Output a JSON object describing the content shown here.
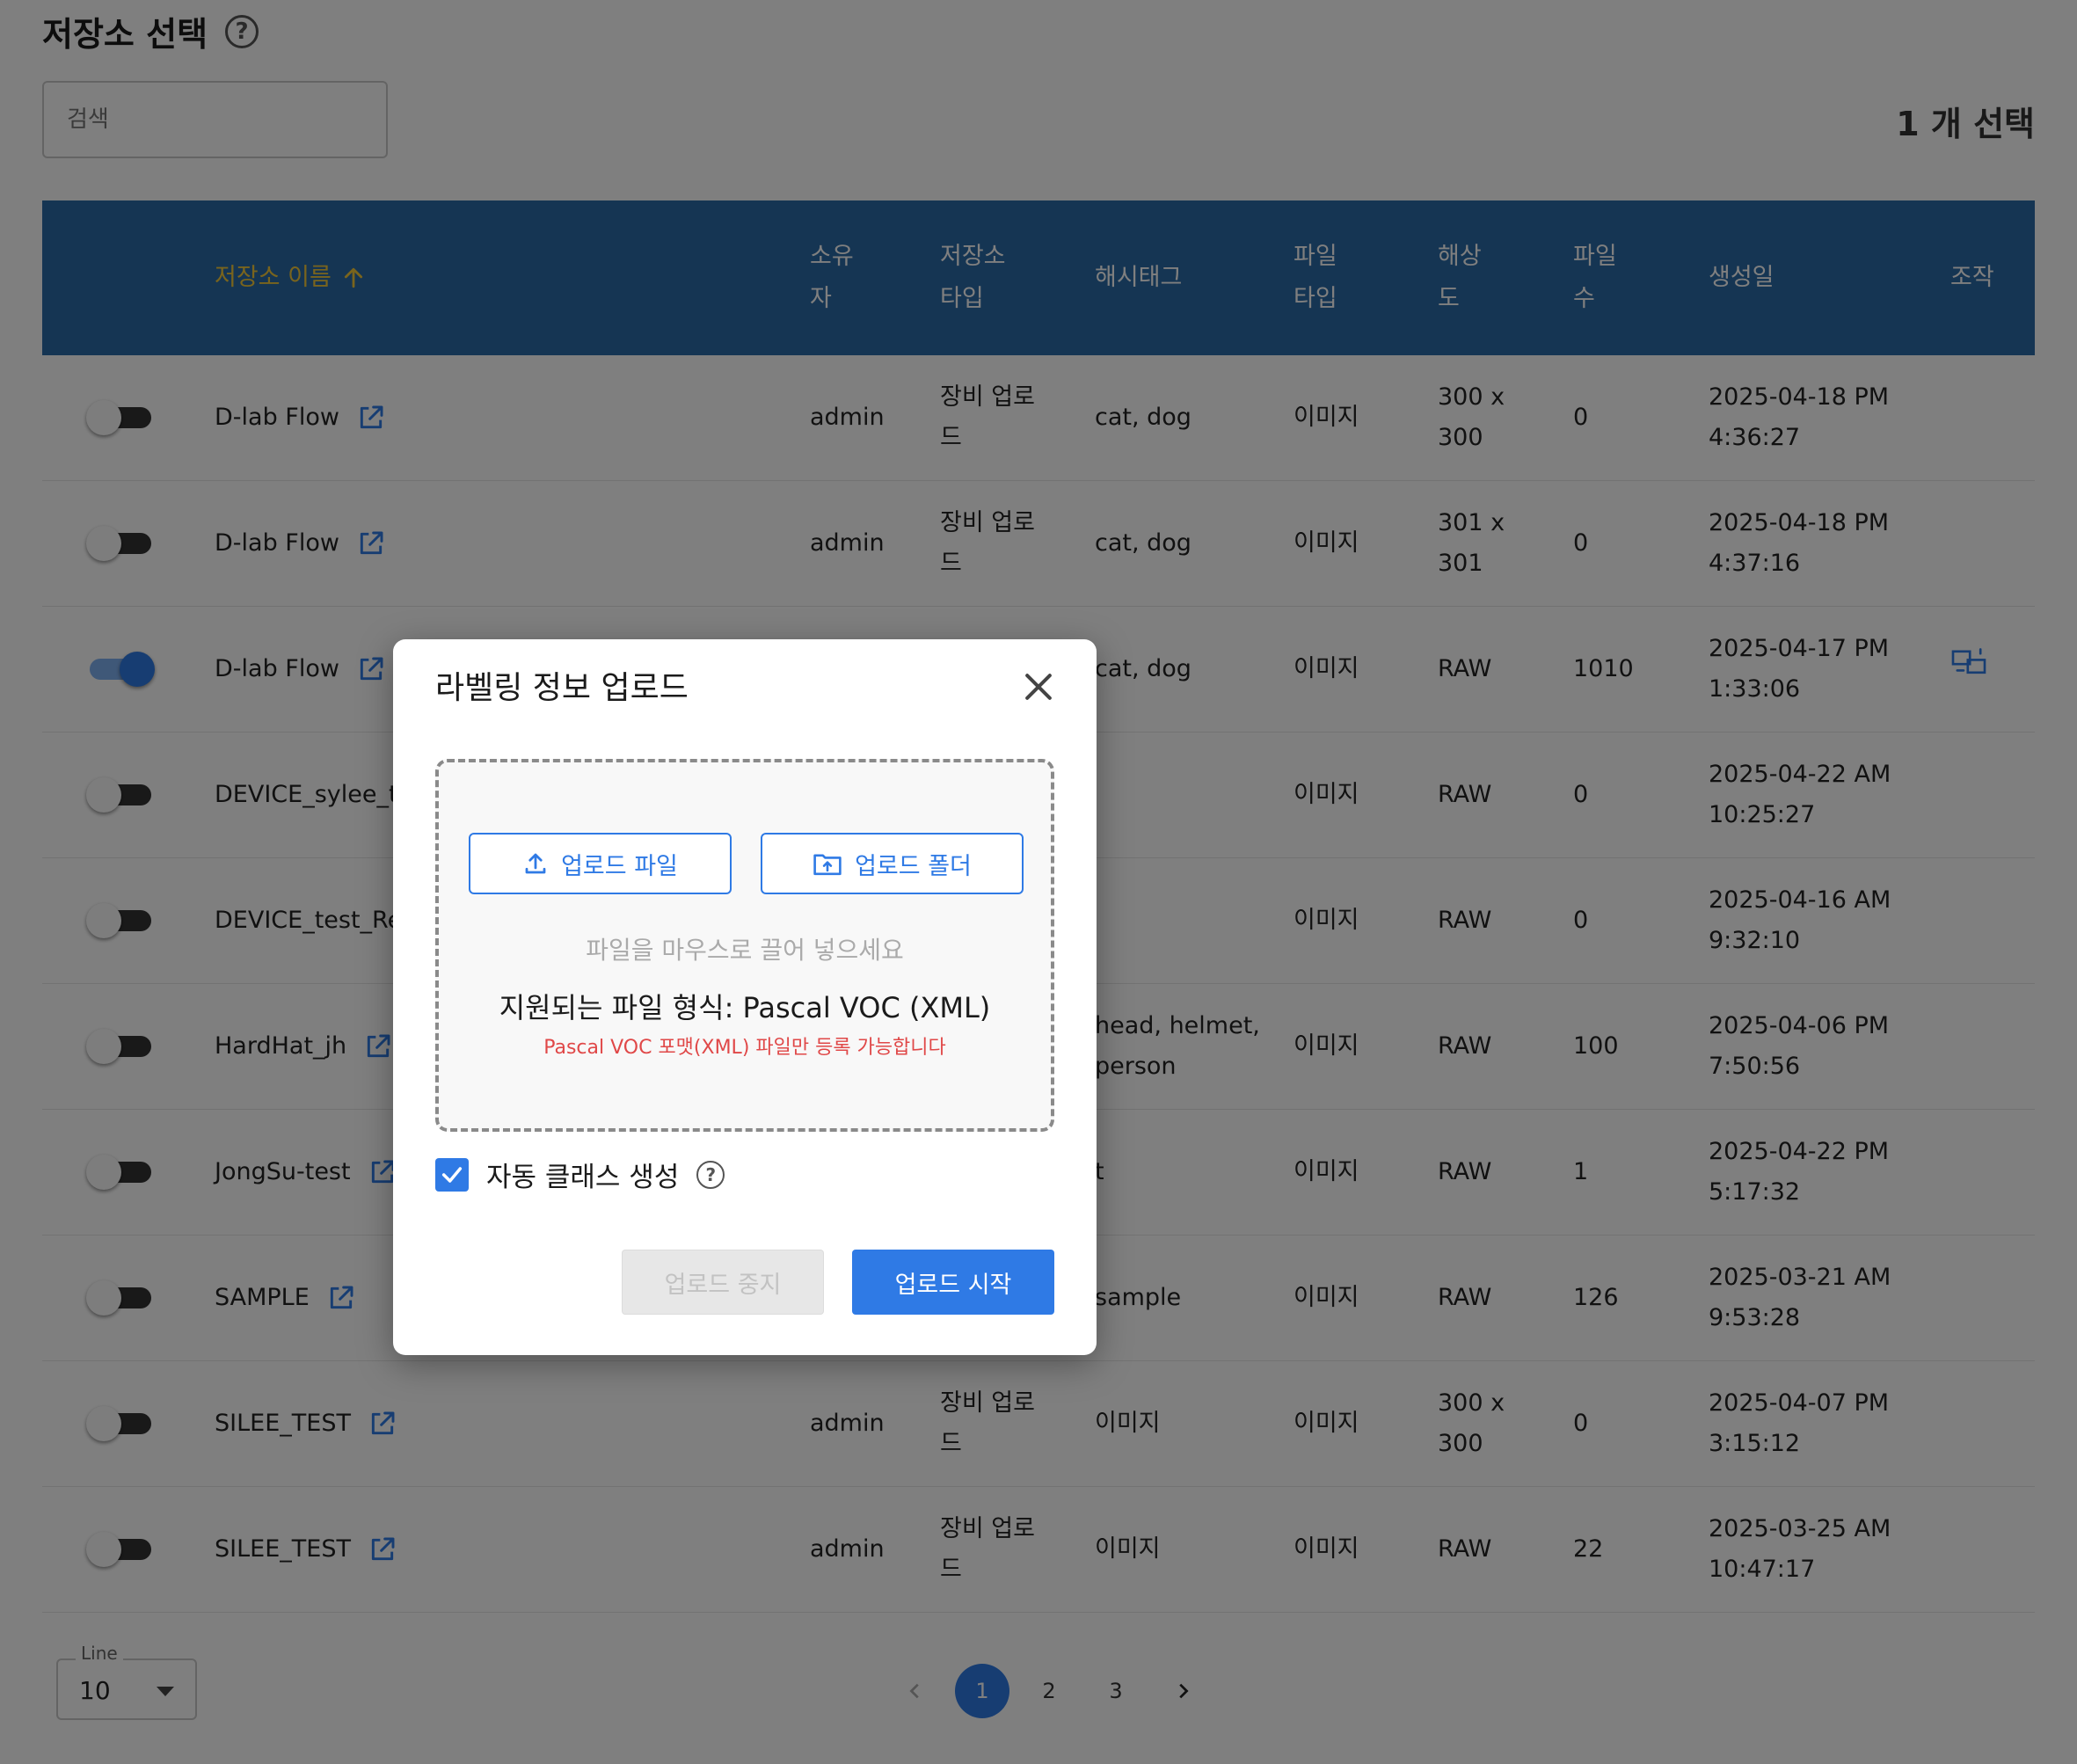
{
  "header": {
    "title": "저장소 선택",
    "help_icon": "help-circle-icon"
  },
  "search": {
    "placeholder": "검색"
  },
  "selection": {
    "count_label": "1 개 선택"
  },
  "table": {
    "columns": {
      "name": "저장소 이름",
      "owner": "소유\n자",
      "repo_type": "저장소\n타입",
      "hashtags": "해시태그",
      "file_type": "파일\n타입",
      "resolution": "해상\n도",
      "file_count": "파일\n수",
      "created": "생성일",
      "actions": "조작"
    },
    "sort": {
      "column": "name",
      "direction": "asc",
      "icon": "arrow-up-icon"
    },
    "rows": [
      {
        "enabled": false,
        "name": "D-lab Flow",
        "owner": "admin",
        "repo_type": "장비 업로\n드",
        "hashtags": "cat, dog",
        "file_type": "이미지",
        "resolution": "300 x\n300",
        "file_count": "0",
        "created": "2025-04-18 PM\n4:36:27"
      },
      {
        "enabled": false,
        "name": "D-lab Flow",
        "owner": "admin",
        "repo_type": "장비 업로\n드",
        "hashtags": "cat, dog",
        "file_type": "이미지",
        "resolution": "301 x\n301",
        "file_count": "0",
        "created": "2025-04-18 PM\n4:37:16"
      },
      {
        "enabled": true,
        "name": "D-lab Flow",
        "owner": "",
        "repo_type": "",
        "hashtags": "cat, dog",
        "file_type": "이미지",
        "resolution": "RAW",
        "file_count": "1010",
        "created": "2025-04-17 PM\n1:33:06",
        "action_icon": "device-sync-icon"
      },
      {
        "enabled": false,
        "name": "DEVICE_sylee_te",
        "owner": "",
        "repo_type": "",
        "hashtags": "",
        "file_type": "이미지",
        "resolution": "RAW",
        "file_count": "0",
        "created": "2025-04-22 AM\n10:25:27"
      },
      {
        "enabled": false,
        "name": "DEVICE_test_Re",
        "owner": "",
        "repo_type": "",
        "hashtags": "",
        "file_type": "이미지",
        "resolution": "RAW",
        "file_count": "0",
        "created": "2025-04-16 AM\n9:32:10"
      },
      {
        "enabled": false,
        "name": "HardHat_jh",
        "owner": "",
        "repo_type": "",
        "hashtags": "head, helmet,\nperson",
        "file_type": "이미지",
        "resolution": "RAW",
        "file_count": "100",
        "created": "2025-04-06 PM\n7:50:56"
      },
      {
        "enabled": false,
        "name": "JongSu-test",
        "owner": "",
        "repo_type": "",
        "hashtags": "t",
        "file_type": "이미지",
        "resolution": "RAW",
        "file_count": "1",
        "created": "2025-04-22 PM\n5:17:32"
      },
      {
        "enabled": false,
        "name": "SAMPLE",
        "owner": "",
        "repo_type": "",
        "hashtags": "sample",
        "file_type": "이미지",
        "resolution": "RAW",
        "file_count": "126",
        "created": "2025-03-21 AM\n9:53:28"
      },
      {
        "enabled": false,
        "name": "SILEE_TEST",
        "owner": "admin",
        "repo_type": "장비 업로\n드",
        "hashtags": "이미지",
        "file_type": "이미지",
        "resolution": "300 x\n300",
        "file_count": "0",
        "created": "2025-04-07 PM\n3:15:12"
      },
      {
        "enabled": false,
        "name": "SILEE_TEST",
        "owner": "admin",
        "repo_type": "장비 업로\n드",
        "hashtags": "이미지",
        "file_type": "이미지",
        "resolution": "RAW",
        "file_count": "22",
        "created": "2025-03-25 AM\n10:47:17"
      }
    ]
  },
  "footer": {
    "line_label": "Line",
    "line_value": "10",
    "pages": [
      "1",
      "2",
      "3"
    ],
    "current_page": "1"
  },
  "modal": {
    "title": "라벨링 정보 업로드",
    "upload_file_label": "업로드 파일",
    "upload_folder_label": "업로드 폴더",
    "drop_hint": "파일을 마우스로 끌어 넣으세요",
    "format_text": "지원되는 파일 형식: Pascal VOC (XML)",
    "format_warning": "Pascal VOC 포맷(XML) 파일만 등록 가능합니다",
    "auto_class_label": "자동 클래스 생성",
    "auto_class_checked": true,
    "stop_label": "업로드 중지",
    "start_label": "업로드 시작"
  },
  "colors": {
    "header_bg": "#2a6aa6",
    "sort_accent": "#f2c93b",
    "primary": "#2f7ae5",
    "warning": "#e04848"
  }
}
